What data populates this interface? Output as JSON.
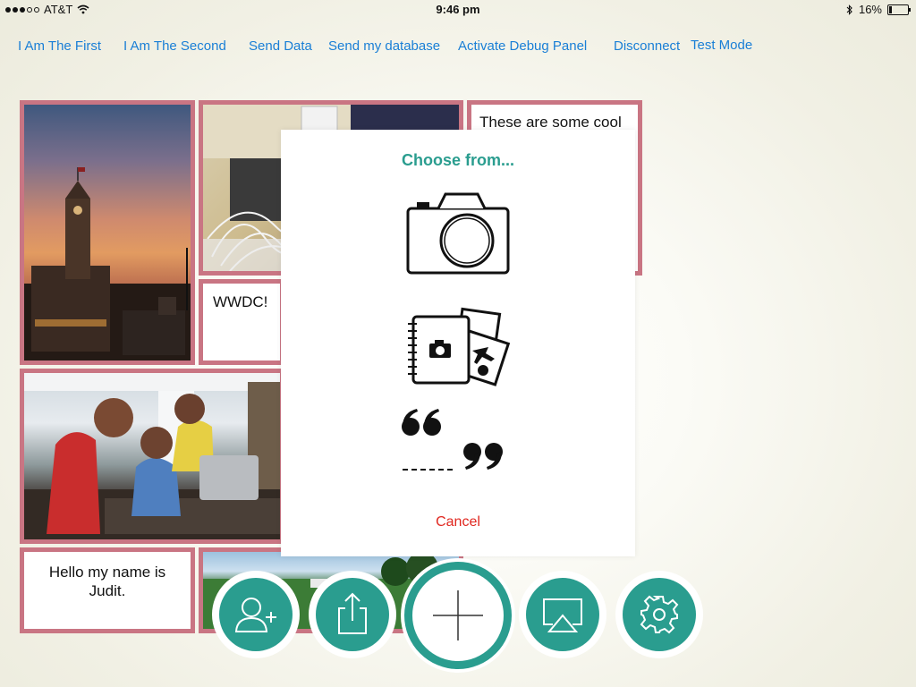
{
  "status_bar": {
    "carrier": "AT&T",
    "time": "9:46 pm",
    "battery": "16%",
    "battery_level": 0.16
  },
  "nav": {
    "links": [
      {
        "label": "I Am The First"
      },
      {
        "label": "I Am The Second"
      },
      {
        "label": "Send Data"
      },
      {
        "label": "Send my database"
      },
      {
        "label": "Activate Debug Panel"
      },
      {
        "label": "Disconnect"
      },
      {
        "label": "Test Mode"
      }
    ]
  },
  "tiles": {
    "cool_text": "These are some cool",
    "wwdc_text": "WWDC!",
    "hello_text": "Hello my name is Judit."
  },
  "dialog": {
    "title": "Choose from...",
    "options": [
      {
        "icon": "camera-icon"
      },
      {
        "icon": "photo-album-icon"
      },
      {
        "icon": "quote-icon"
      }
    ],
    "cancel_label": "Cancel"
  },
  "toolbar": {
    "buttons": [
      {
        "icon": "add-user-icon"
      },
      {
        "icon": "share-icon"
      },
      {
        "icon": "add-icon"
      },
      {
        "icon": "airplay-icon"
      },
      {
        "icon": "settings-gear-icon"
      }
    ]
  },
  "colors": {
    "accent": "#2a9d8f",
    "link": "#1a7fd6",
    "tile_border": "#c97583",
    "cancel": "#e0271f"
  }
}
